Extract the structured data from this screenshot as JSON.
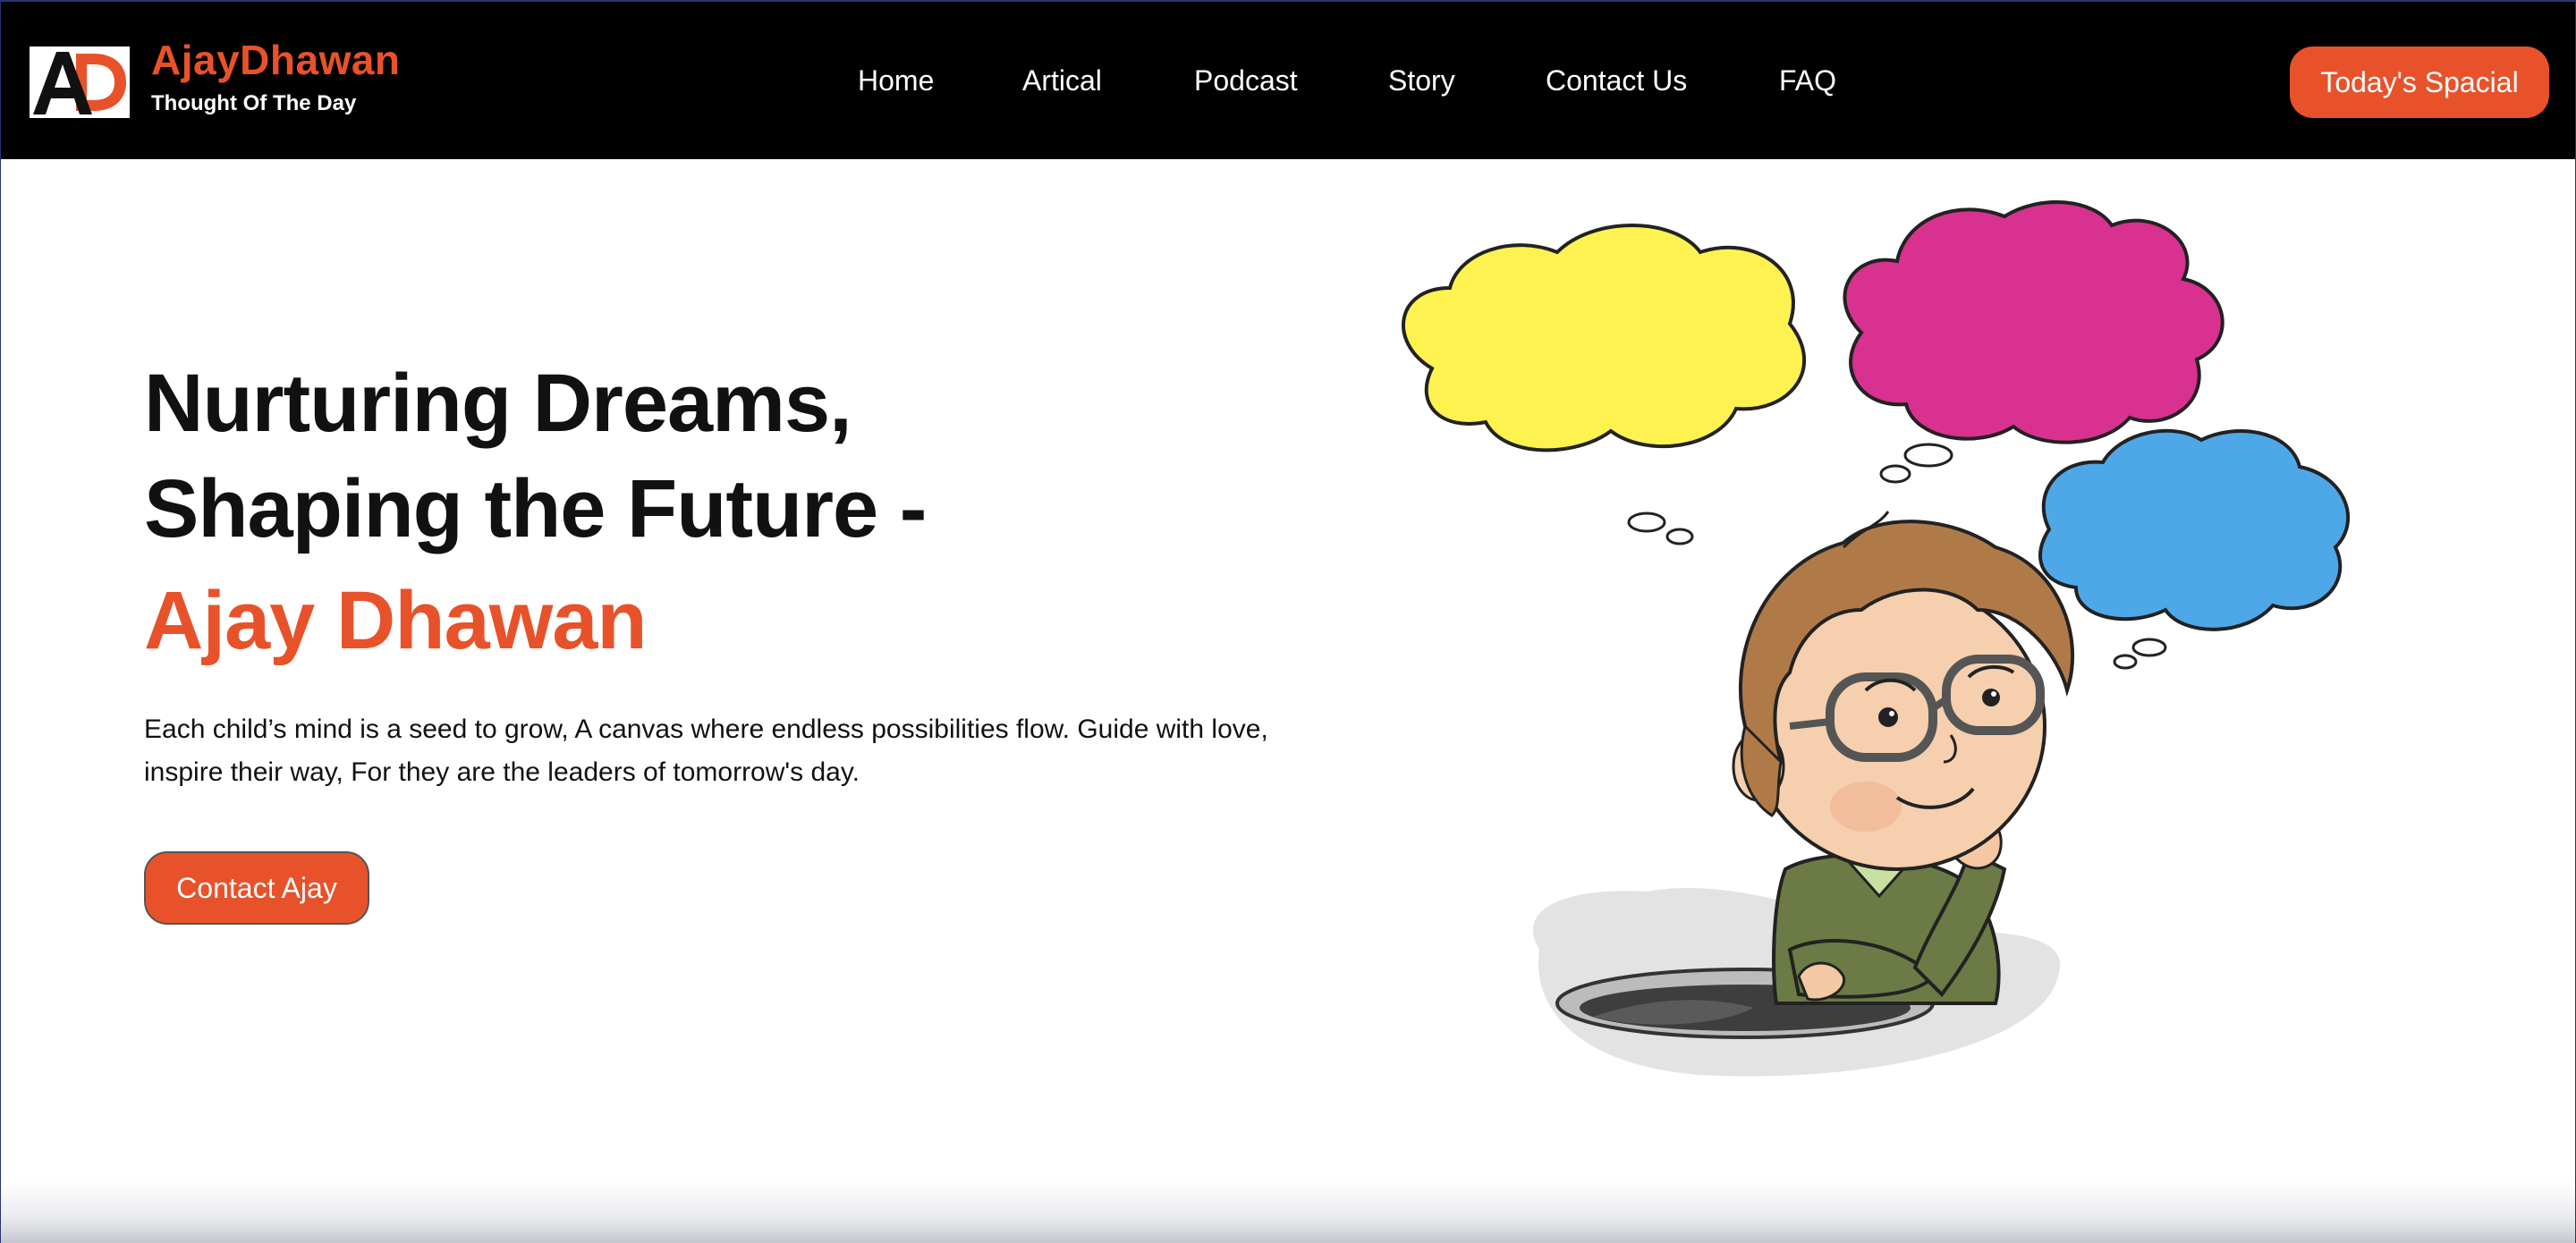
{
  "header": {
    "brand_name": "AjayDhawan",
    "tagline": "Thought Of The Day",
    "logo_text": "AD",
    "nav": [
      {
        "label": "Home"
      },
      {
        "label": "Artical"
      },
      {
        "label": "Podcast"
      },
      {
        "label": "Story"
      },
      {
        "label": "Contact Us"
      },
      {
        "label": "FAQ"
      }
    ],
    "special_button": "Today's Spacial"
  },
  "hero": {
    "title_line1": "Nurturing Dreams,",
    "title_line2": "Shaping the Future -",
    "name": "Ajay Dhawan",
    "description": "Each child’s mind is a seed to grow, A canvas where endless possibilities flow. Guide with love, inspire their way, For they are the leaders of tomorrow's day.",
    "contact_button": "Contact Ajay",
    "illustration": "thinking-boy-with-thought-bubbles"
  },
  "colors": {
    "accent": "#e8522a",
    "navbar_bg": "#000000",
    "bubble_yellow": "#fdf250",
    "bubble_pink": "#d93190",
    "bubble_blue": "#4ea8e8"
  }
}
